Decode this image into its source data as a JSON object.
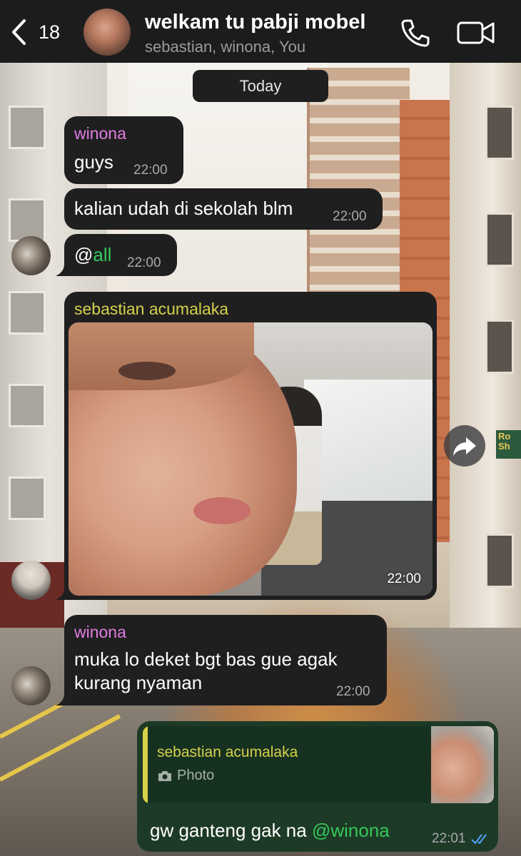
{
  "header": {
    "back_count": "18",
    "title": "welkam tu pabji mobel",
    "subtitle": "sebastian, winona, You"
  },
  "date_chip": "Today",
  "messages": [
    {
      "sender": "winona",
      "text": "guys",
      "time": "22:00"
    },
    {
      "text": "kalian udah di sekolah blm",
      "time": "22:00"
    },
    {
      "prefix": "@",
      "mention": "all",
      "time": "22:00"
    },
    {
      "sender": "sebastian acumalaka",
      "type": "photo",
      "time": "22:00"
    },
    {
      "sender": "winona",
      "lines": [
        "muka lo deket bgt bas gue agak",
        "kurang nyaman"
      ],
      "time": "22:00"
    }
  ],
  "outgoing": {
    "reply_to": {
      "sender": "sebastian acumalaka",
      "type_label": "Photo"
    },
    "text": "gw ganteng gak na ",
    "mention": "@winona",
    "time": "22:01",
    "status": "read"
  },
  "colors": {
    "bubble_in": "#1f1f20",
    "bubble_out": "#1d3a27",
    "winona": "#e27de2",
    "sebastian": "#d6d24a",
    "mention": "#34c75a",
    "read_ticks": "#4fa3ff"
  },
  "icons": [
    "back-chevron-icon",
    "phone-icon",
    "video-camera-icon",
    "forward-icon",
    "camera-icon",
    "read-receipt-icon"
  ]
}
